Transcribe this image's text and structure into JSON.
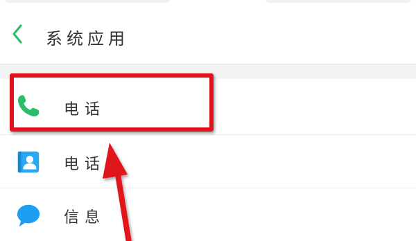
{
  "header": {
    "title": "系统应用",
    "back_icon": "chevron-left-icon"
  },
  "items": [
    {
      "label": "电话",
      "icon": "phone-handset-icon"
    },
    {
      "label": "电话",
      "icon": "contacts-icon"
    },
    {
      "label": "信息",
      "icon": "message-bubble-icon"
    }
  ],
  "colors": {
    "accent_green": "#2cbc6b",
    "contacts_blue": "#29a7f0",
    "message_blue": "#1e9ef2",
    "highlight_red": "#e0121b"
  }
}
